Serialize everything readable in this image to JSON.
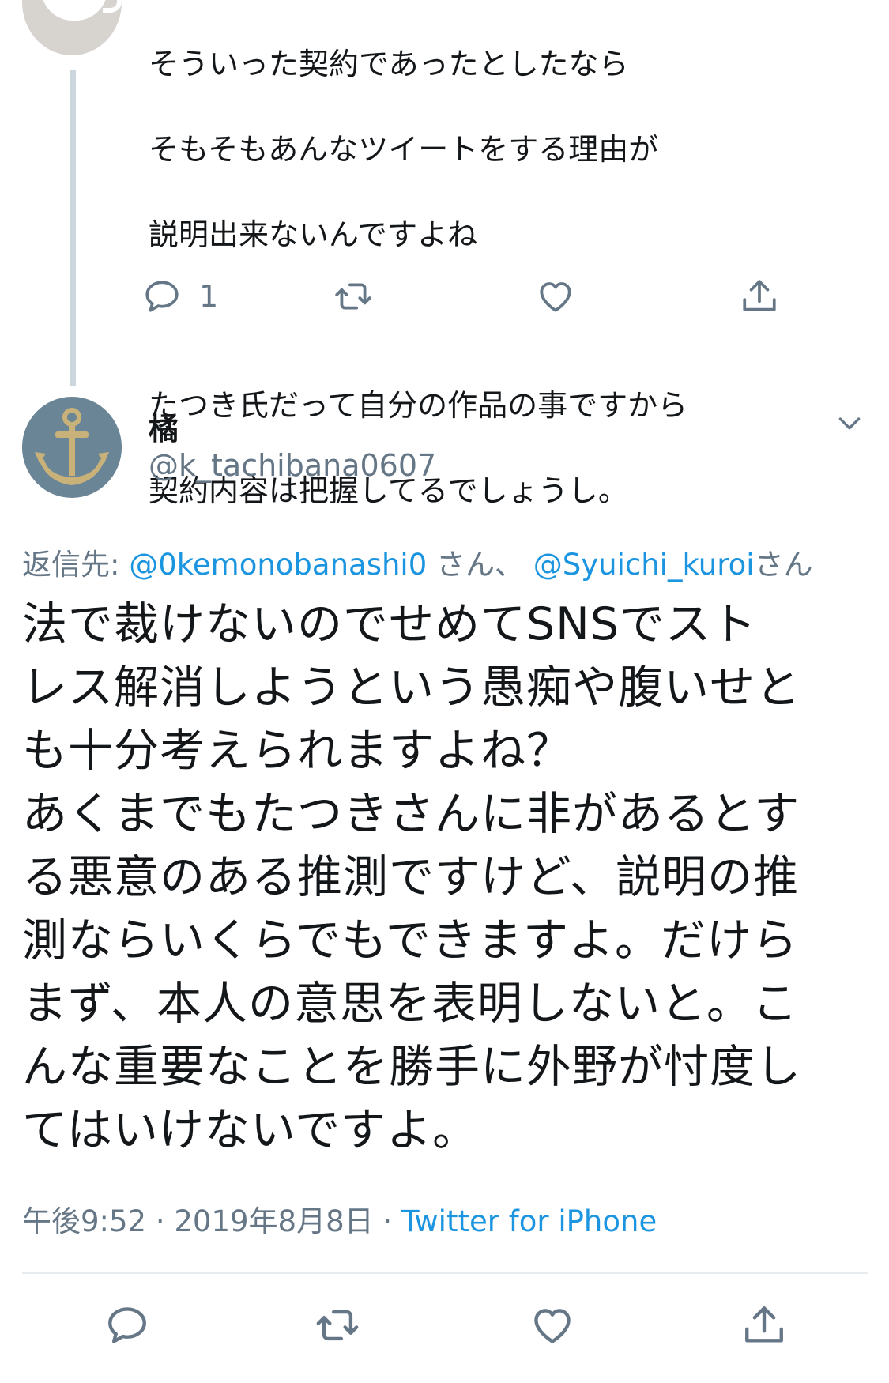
{
  "previous_tweet": {
    "lines": [
      "そういった契約であったとしたなら",
      "そもそもあんなツイートをする理由が",
      "説明出来ないんですよね",
      "",
      "たつき氏だって自分の作品の事ですから",
      "契約内容は把握してるでしょうし。"
    ],
    "reply_count": "1",
    "icons": [
      "reply-icon",
      "retweet-icon",
      "like-icon",
      "share-icon"
    ]
  },
  "main_tweet": {
    "display_name": "橘",
    "handle": "@k_tachibana0607",
    "reply_prefix": "返信先: ",
    "mention1": "@0kemonobanashi0",
    "mention_sep": " さん、 ",
    "mention2": "@Syuichi_kuroi",
    "mention_suffix": "さん",
    "text_lines": [
      "法で裁けないのでせめてSNSでスト",
      "レス解消しようという愚痴や腹いせと",
      "も十分考えられますよね？",
      "あくまでもたつきさんに非があるとす",
      "る悪意のある推測ですけど、説明の推",
      "測ならいくらでもできますよ。だけら",
      "まず、本人の意思を表明しないと。こ",
      "んな重要なことを勝手に外野が忖度し",
      "てはいけないですよ。"
    ],
    "time": "午後9:52",
    "sep1": " · ",
    "date": "2019年8月8日",
    "sep2": " · ",
    "client": "Twitter for iPhone",
    "icons": [
      "reply-icon",
      "retweet-icon",
      "like-icon",
      "share-icon",
      "chevron-down-icon",
      "anchor-icon"
    ]
  },
  "colors": {
    "link": "#1b95e0",
    "secondary_text": "#657786",
    "thread_line": "#ccd6dd",
    "divider": "#e6ecf0"
  }
}
